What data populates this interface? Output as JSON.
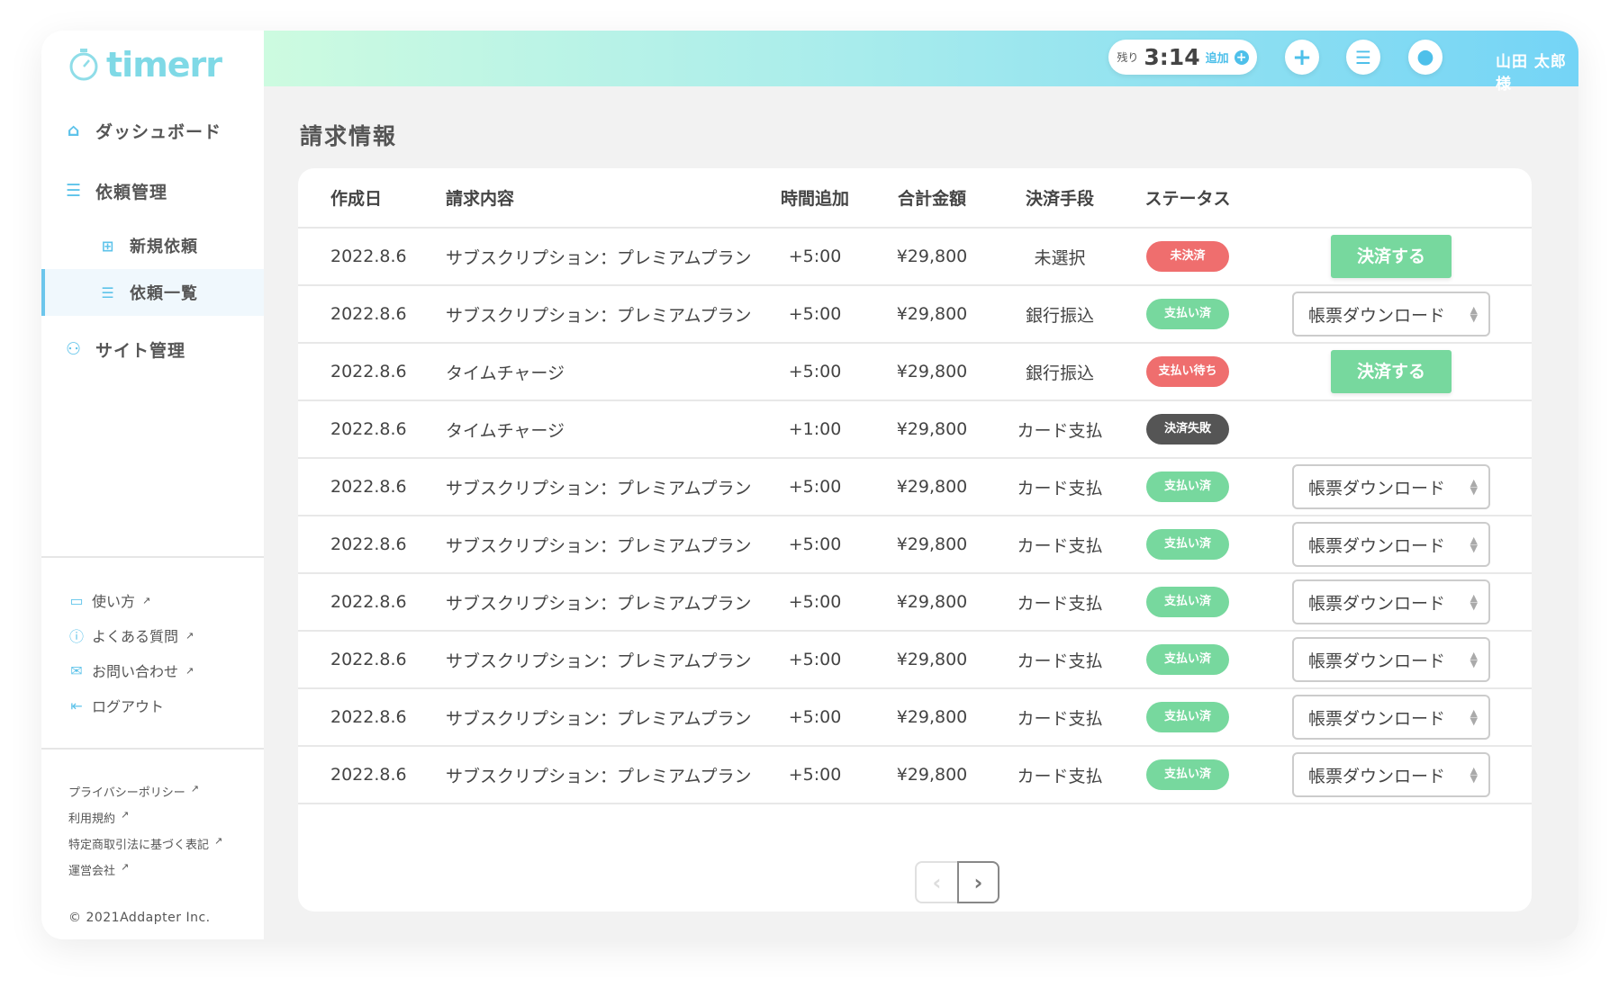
{
  "app": {
    "logo": "timerr"
  },
  "sidebar": {
    "items": [
      {
        "label": "ダッシュボード",
        "icon": "home-icon"
      },
      {
        "label": "依頼管理",
        "icon": "list-icon"
      },
      {
        "label": "新規依頼",
        "icon": "plus-square-icon"
      },
      {
        "label": "依頼一覧",
        "icon": "list-icon",
        "active": true
      },
      {
        "label": "サイト管理",
        "icon": "sitemap-icon"
      }
    ],
    "links": [
      {
        "label": "使い方",
        "icon": "monitor-icon"
      },
      {
        "label": "よくある質問",
        "icon": "question-icon"
      },
      {
        "label": "お問い合わせ",
        "icon": "mail-icon"
      },
      {
        "label": "ログアウト",
        "icon": "logout-icon"
      }
    ],
    "footer_links": [
      "プライバシーポリシー",
      "利用規約",
      "特定商取引法に基づく表記",
      "運営会社"
    ],
    "copyright": "© 2021Addapter Inc."
  },
  "header": {
    "remaining_label": "残り",
    "remaining_time": "3:14",
    "add_label": "追加",
    "user_name": "山田 太郎 様"
  },
  "page": {
    "title": "請求情報"
  },
  "table": {
    "columns": [
      "作成日",
      "請求内容",
      "時間追加",
      "合計金額",
      "決済手段",
      "ステータス",
      ""
    ],
    "pay_label": "決済する",
    "download_label": "帳票ダウンロード",
    "rows": [
      {
        "date": "2022.8.6",
        "item": "サブスクリプション：プレミアムプラン",
        "time": "+5:00",
        "amount": "¥29,800",
        "method": "未選択",
        "status": "未決済",
        "status_color": "#ef6e6e",
        "action": "pay"
      },
      {
        "date": "2022.8.6",
        "item": "サブスクリプション：プレミアムプラン",
        "time": "+5:00",
        "amount": "¥29,800",
        "method": "銀行振込",
        "status": "支払い済",
        "status_color": "#77d89e",
        "action": "download"
      },
      {
        "date": "2022.8.6",
        "item": "タイムチャージ",
        "time": "+5:00",
        "amount": "¥29,800",
        "method": "銀行振込",
        "status": "支払い待ち",
        "status_color": "#ef6e6e",
        "action": "pay"
      },
      {
        "date": "2022.8.6",
        "item": "タイムチャージ",
        "time": "+1:00",
        "amount": "¥29,800",
        "method": "カード支払",
        "status": "決済失敗",
        "status_color": "#555555",
        "action": "none"
      },
      {
        "date": "2022.8.6",
        "item": "サブスクリプション：プレミアムプラン",
        "time": "+5:00",
        "amount": "¥29,800",
        "method": "カード支払",
        "status": "支払い済",
        "status_color": "#77d89e",
        "action": "download"
      },
      {
        "date": "2022.8.6",
        "item": "サブスクリプション：プレミアムプラン",
        "time": "+5:00",
        "amount": "¥29,800",
        "method": "カード支払",
        "status": "支払い済",
        "status_color": "#77d89e",
        "action": "download"
      },
      {
        "date": "2022.8.6",
        "item": "サブスクリプション：プレミアムプラン",
        "time": "+5:00",
        "amount": "¥29,800",
        "method": "カード支払",
        "status": "支払い済",
        "status_color": "#77d89e",
        "action": "download"
      },
      {
        "date": "2022.8.6",
        "item": "サブスクリプション：プレミアムプラン",
        "time": "+5:00",
        "amount": "¥29,800",
        "method": "カード支払",
        "status": "支払い済",
        "status_color": "#77d89e",
        "action": "download"
      },
      {
        "date": "2022.8.6",
        "item": "サブスクリプション：プレミアムプラン",
        "time": "+5:00",
        "amount": "¥29,800",
        "method": "カード支払",
        "status": "支払い済",
        "status_color": "#77d89e",
        "action": "download"
      },
      {
        "date": "2022.8.6",
        "item": "サブスクリプション：プレミアムプラン",
        "time": "+5:00",
        "amount": "¥29,800",
        "method": "カード支払",
        "status": "支払い済",
        "status_color": "#77d89e",
        "action": "download"
      }
    ]
  },
  "pagination": {
    "prev_enabled": false,
    "next_enabled": true
  }
}
